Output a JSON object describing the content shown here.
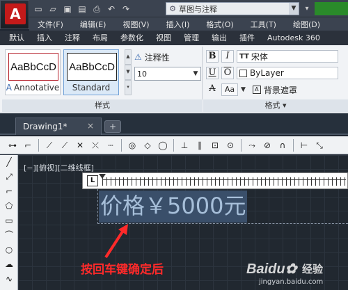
{
  "app": {
    "logo": "A"
  },
  "quick_access": {
    "icons": [
      "new-file-icon",
      "open-file-icon",
      "save-icon",
      "save-as-icon",
      "print-icon",
      "undo-icon",
      "redo-icon"
    ],
    "workspace": "草图与注释"
  },
  "menubar": {
    "items": [
      "文件(F)",
      "编辑(E)",
      "视图(V)",
      "插入(I)",
      "格式(O)",
      "工具(T)",
      "绘图(D)"
    ]
  },
  "ribbon_tabs": {
    "items": [
      "默认",
      "插入",
      "注释",
      "布局",
      "参数化",
      "视图",
      "管理",
      "输出",
      "插件",
      "Autodesk 360"
    ]
  },
  "ribbon": {
    "style_panel": {
      "samples": [
        {
          "preview": "AaBbCcD",
          "caption": "Annotative",
          "annotative_icon": "A"
        },
        {
          "preview": "AaBbCcD",
          "caption": "Standard"
        }
      ],
      "annotative_label": "注释性",
      "text_height": "10",
      "title": "样式"
    },
    "format_panel": {
      "bold": "B",
      "italic": "I",
      "underline": "U",
      "overline": "O",
      "strike": "A",
      "case": "Aa",
      "font": "宋体",
      "font_icon": "TT",
      "color": "ByLayer",
      "background_mask": "背景遮罩",
      "title": "格式 ▾"
    }
  },
  "file_tabs": {
    "active": "Drawing1*",
    "close": "×",
    "new": "+"
  },
  "viewport": {
    "label": "[−][俯视][二维线框]"
  },
  "ruler": {
    "tab_type": "L"
  },
  "mtext": {
    "content": "价格￥5000元"
  },
  "annotation": {
    "text": "按回车键确定后",
    "color": "#ff2a2a"
  },
  "watermark": {
    "brand": "Baidu",
    "experience": "经验",
    "url": "jingyan.baidu.com"
  },
  "colors": {
    "accent_red": "#c41a1a",
    "selection": "#3a4f6a",
    "canvas": "#212830"
  }
}
